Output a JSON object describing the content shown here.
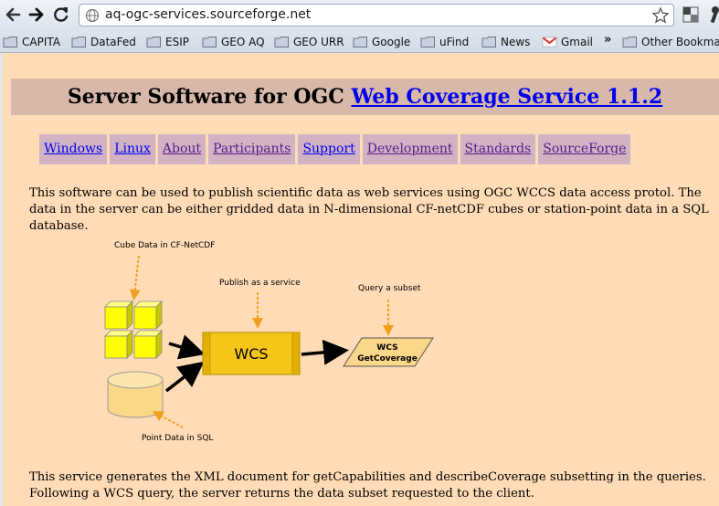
{
  "browser": {
    "url": "aq-ogc-services.sourceforge.net",
    "bookmarks": [
      {
        "label": "CAPITA",
        "icon": "folder-icon"
      },
      {
        "label": "DataFed",
        "icon": "folder-icon"
      },
      {
        "label": "ESIP",
        "icon": "folder-icon"
      },
      {
        "label": "GEO AQ",
        "icon": "folder-icon"
      },
      {
        "label": "GEO URR",
        "icon": "folder-icon"
      },
      {
        "label": "Google",
        "icon": "folder-icon"
      },
      {
        "label": "uFind",
        "icon": "folder-icon"
      },
      {
        "label": "News",
        "icon": "folder-icon"
      },
      {
        "label": "Gmail",
        "icon": "gmail-icon"
      }
    ],
    "overflow_chevron": "»",
    "other_bookmarks": "Other Bookmarks"
  },
  "page": {
    "title_prefix": "Server Software for OGC ",
    "title_link": "Web Coverage Service 1.1.2",
    "menu": [
      "Windows",
      "Linux",
      "About",
      "Participants",
      "Support",
      "Development",
      "Standards",
      "SourceForge"
    ],
    "para1": "This software can be used to publish scientific data as web services using OGC WCCS data access protol. The data in the server can be either gridded data in N-dimensional CF-netCDF cubes or station-point data in a SQL database.",
    "para2": "This service generates the XML document for getCapabilities and describeCoverage subsetting in the queries. Following a WCS query, the server returns the data subset requested to the client."
  },
  "diagram": {
    "cube_label": "Cube Data in CF-NetCDF",
    "publish_label": "Publish as a service",
    "query_label": "Query a subset",
    "wcs_box": "WCS",
    "output_line1": "WCS",
    "output_line2": "GetCoverage",
    "point_label": "Point Data in SQL"
  },
  "colors": {
    "page_bg": "#ffdcb6",
    "title_bar": "#d8b8a8",
    "menu_bg": "#d2b3c4",
    "link": "#0000ee",
    "visited": "#551a8b",
    "cube": "#ffff00",
    "wcs_box": "#f5c518",
    "dashed_arrow": "#f0a020"
  }
}
